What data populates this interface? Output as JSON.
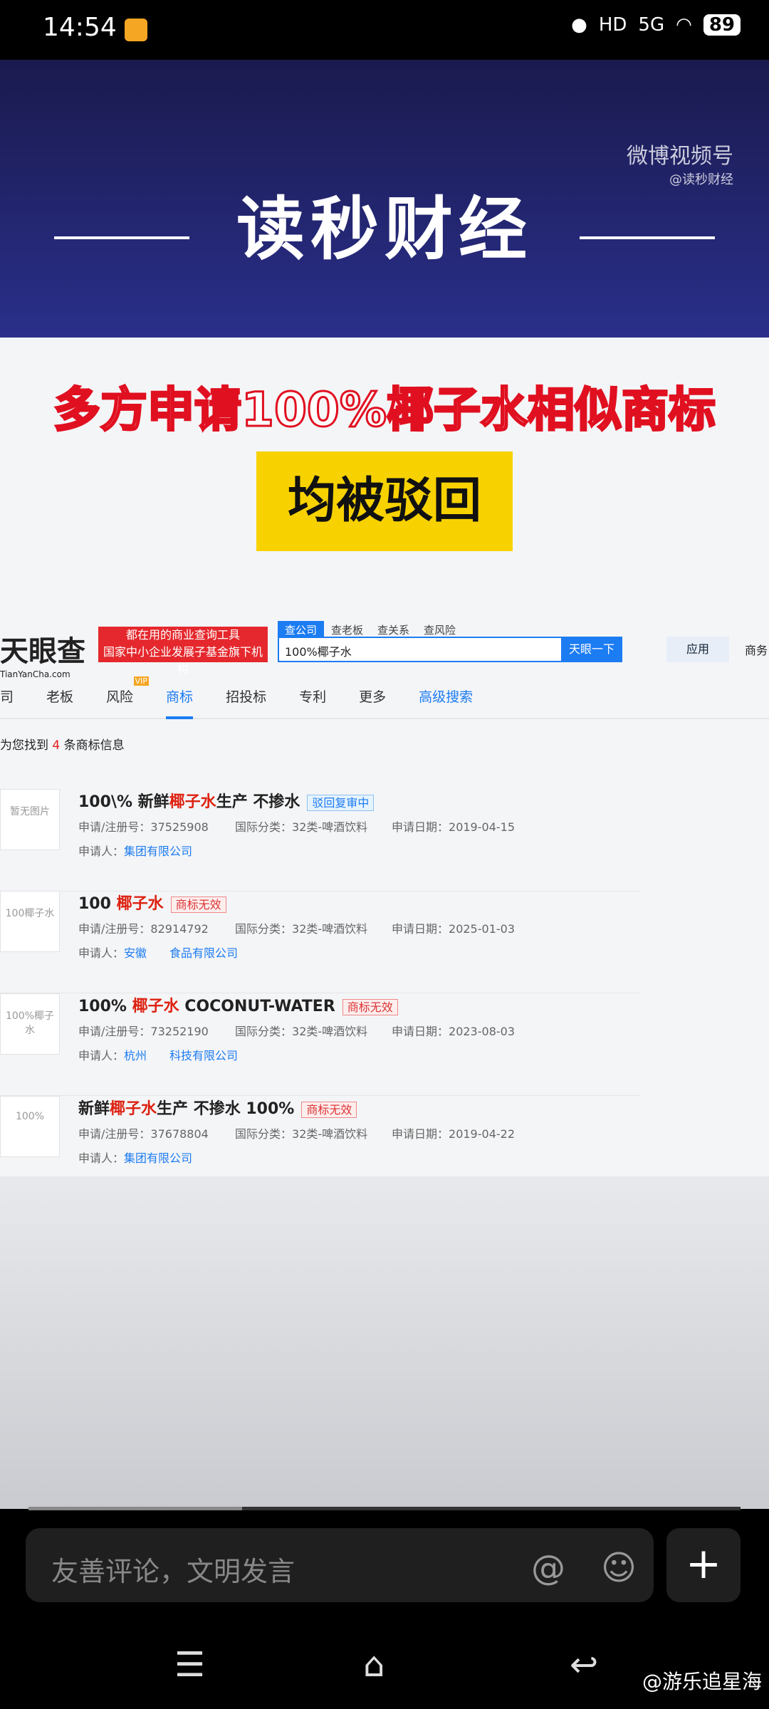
{
  "status": {
    "time": "14:54",
    "network": "5G",
    "hd": "HD",
    "battery": "89"
  },
  "banner": {
    "watermark": "微博视频号",
    "watermark_handle": "@读秒财经",
    "brand": "读秒财经"
  },
  "headline": "多方申请100%椰子水相似商标",
  "subhead": "均被驳回",
  "site": {
    "logo": "天眼查",
    "logo_sub": "TianYanCha.com",
    "ad_line1": "都在用的商业查询工具",
    "ad_line2": "国家中小企业发展子基金旗下机构",
    "search_tabs": [
      "查公司",
      "查老板",
      "查关系",
      "查风险"
    ],
    "search_value": "100%椰子水",
    "search_button": "天眼一下",
    "apps": "应用",
    "biz": "商务",
    "nav_tabs": [
      "司",
      "老板",
      "风险",
      "商标",
      "招投标",
      "专利",
      "更多",
      "高级搜索"
    ],
    "vip": "VIP",
    "found_prefix": "为您找到",
    "found_count": "4",
    "found_suffix": "条商标信息",
    "labels": {
      "reg": "申请/注册号：",
      "class": "国际分类：",
      "date": "申请日期：",
      "applicant": "申请人："
    },
    "results": [
      {
        "t1": "100\\% 新鲜",
        "t2": "椰子水",
        "t3": "生产 不掺水",
        "badge": "驳回复审中",
        "badge_type": "blue",
        "thumb": "暂无图片",
        "reg": "37525908",
        "class": "32类-啤酒饮料",
        "date": "2019-04-15",
        "applicant": "集团有限公司"
      },
      {
        "t1": "100 ",
        "t2": "椰子水",
        "t3": "",
        "badge": "商标无效",
        "badge_type": "red",
        "thumb": "100椰子水",
        "reg": "82914792",
        "class": "32类-啤酒饮料",
        "date": "2025-01-03",
        "applicant": "安徽　　食品有限公司"
      },
      {
        "t1": "100% ",
        "t2": "椰子水",
        "t3": " COCONUT-WATER",
        "badge": "商标无效",
        "badge_type": "red",
        "thumb": "100%椰子水",
        "reg": "73252190",
        "class": "32类-啤酒饮料",
        "date": "2023-08-03",
        "applicant": "杭州　　科技有限公司"
      },
      {
        "t1": "新鲜",
        "t2": "椰子水",
        "t3": "生产 不掺水 100%",
        "badge": "商标无效",
        "badge_type": "red",
        "thumb": "100%",
        "reg": "37678804",
        "class": "32类-啤酒饮料",
        "date": "2019-04-22",
        "applicant": "集团有限公司"
      }
    ]
  },
  "video_progress": 0.3,
  "comment": {
    "placeholder": "友善评论，文明发言",
    "at": "@",
    "emoji": "☺",
    "plus": "+"
  },
  "watermark_bottom": "@游乐追星海"
}
